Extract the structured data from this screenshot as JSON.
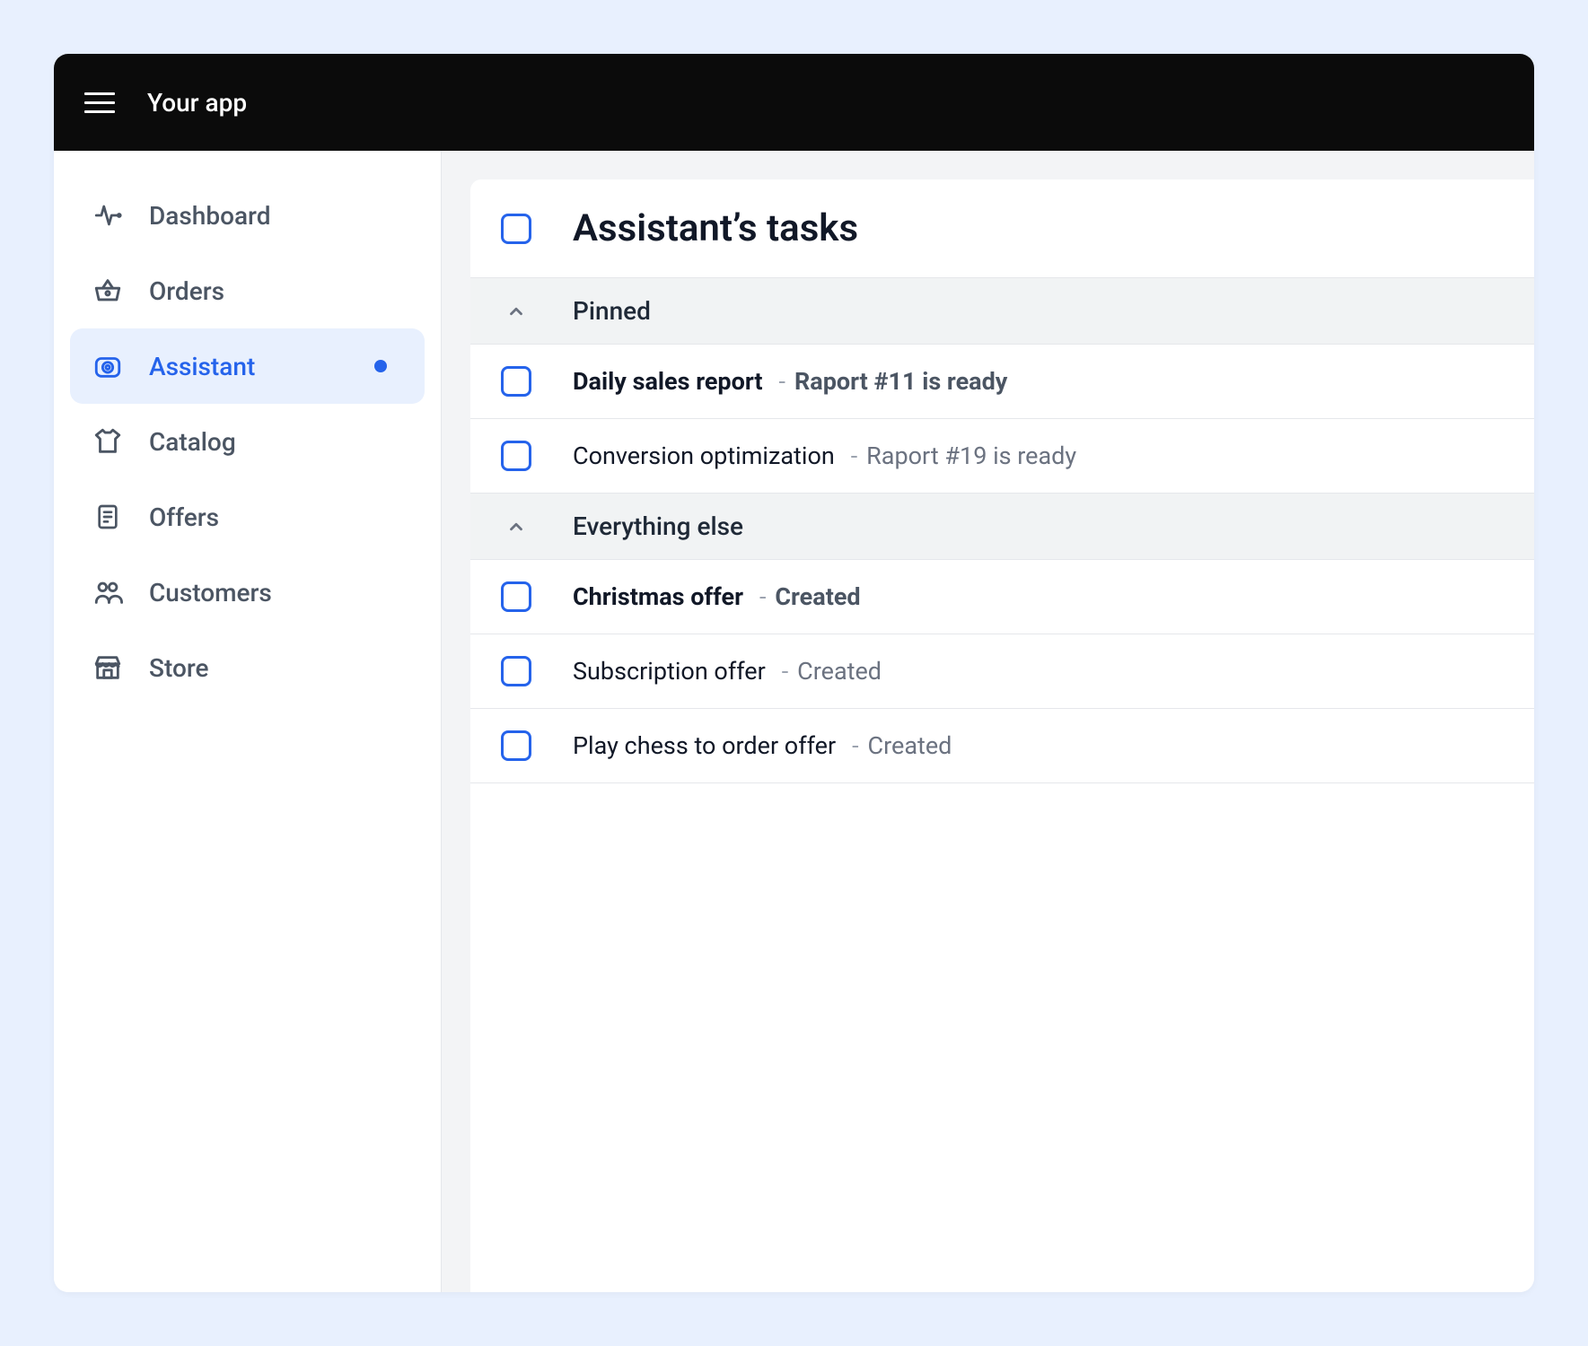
{
  "header": {
    "title": "Your app"
  },
  "sidebar": {
    "items": [
      {
        "label": "Dashboard",
        "icon": "pulse-icon",
        "active": false,
        "hasDot": false
      },
      {
        "label": "Orders",
        "icon": "basket-icon",
        "active": false,
        "hasDot": false
      },
      {
        "label": "Assistant",
        "icon": "camera-icon",
        "active": true,
        "hasDot": true
      },
      {
        "label": "Catalog",
        "icon": "shirt-icon",
        "active": false,
        "hasDot": false
      },
      {
        "label": "Offers",
        "icon": "document-icon",
        "active": false,
        "hasDot": false
      },
      {
        "label": "Customers",
        "icon": "users-icon",
        "active": false,
        "hasDot": false
      },
      {
        "label": "Store",
        "icon": "store-icon",
        "active": false,
        "hasDot": false
      }
    ]
  },
  "main": {
    "title": "Assistant’s tasks",
    "sections": [
      {
        "label": "Pinned",
        "tasks": [
          {
            "title": "Daily sales report",
            "status": "Raport #11 is ready",
            "bold": true
          },
          {
            "title": "Conversion optimization",
            "status": "Raport #19 is ready",
            "bold": false
          }
        ]
      },
      {
        "label": "Everything else",
        "tasks": [
          {
            "title": "Christmas offer",
            "status": "Created",
            "bold": true
          },
          {
            "title": "Subscription offer",
            "status": "Created",
            "bold": false
          },
          {
            "title": "Play chess to order offer",
            "status": "Created",
            "bold": false
          }
        ]
      }
    ],
    "separator": "-"
  }
}
